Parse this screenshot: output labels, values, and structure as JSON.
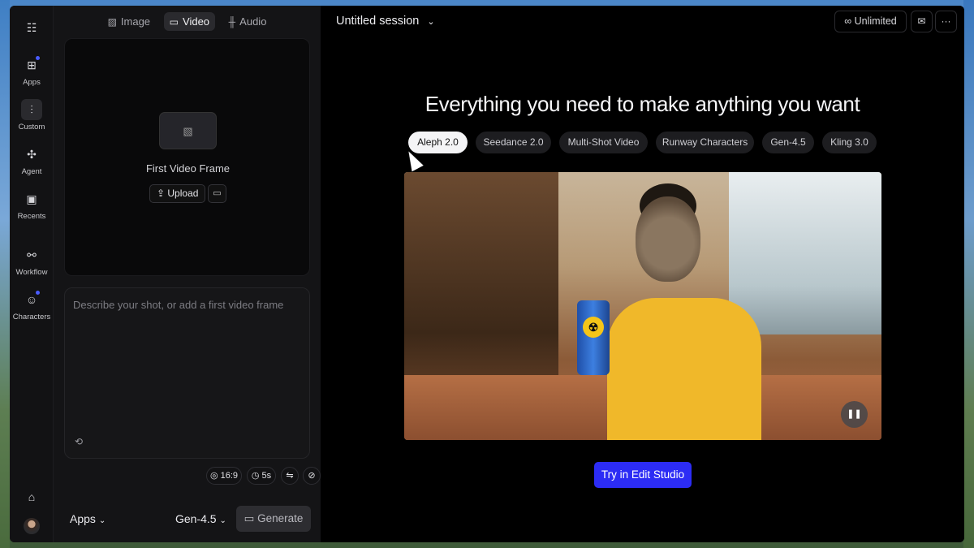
{
  "rail": {
    "items": [
      {
        "label": "",
        "icon": "layout-icon"
      },
      {
        "label": "Apps",
        "icon": "apps-icon"
      },
      {
        "label": "Custom",
        "icon": "sliders-icon"
      },
      {
        "label": "Agent",
        "icon": "agent-icon"
      },
      {
        "label": "Recents",
        "icon": "recents-icon"
      },
      {
        "label": "Workflow",
        "icon": "workflow-icon"
      },
      {
        "label": "Characters",
        "icon": "characters-icon"
      }
    ]
  },
  "panel": {
    "tabs": [
      "Image",
      "Video",
      "Audio"
    ],
    "active_tab": "Video",
    "frame_title": "First Video Frame",
    "upload_label": "Upload",
    "prompt_placeholder": "Describe your shot, or add a first video frame",
    "aspect": "16:9",
    "duration": "5s",
    "apps_label": "Apps",
    "model_label": "Gen-4.5",
    "generate_label": "Generate"
  },
  "header": {
    "session_title": "Untitled session",
    "plan_label": "Unlimited"
  },
  "main": {
    "headline": "Everything you need to make anything you want",
    "models": [
      "Aleph 2.0",
      "Seedance 2.0",
      "Multi-Shot Video",
      "Runway Characters",
      "Gen-4.5",
      "Kling 3.0"
    ],
    "active_model": "Aleph 2.0",
    "cta_label": "Try in Edit Studio"
  },
  "colors": {
    "accent": "#2c2cf5",
    "window_bg": "#0b0b0c",
    "dot": "#4a5cff"
  }
}
